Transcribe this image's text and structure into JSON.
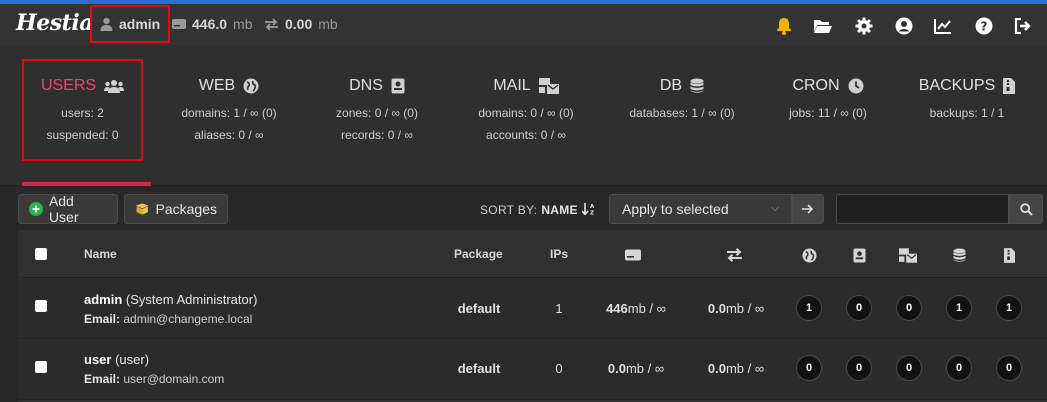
{
  "colors": {
    "accent": "#d0264f",
    "highlight": "#e10b16",
    "bell": "#f0b400",
    "addGreen": "#2fb34b"
  },
  "topbar": {
    "logo": "Hestia",
    "user": "admin",
    "disk_value": "446.0",
    "disk_unit": "mb",
    "bandwidth_value": "0.00",
    "bandwidth_unit": "mb",
    "icons": [
      "bell-icon",
      "folder-open-icon",
      "gear-icon",
      "user-circle-icon",
      "chart-line-icon",
      "question-icon",
      "logout-icon"
    ]
  },
  "stats": [
    {
      "title": "USERS",
      "icon": "users-icon",
      "lines": [
        "users: 2",
        "suspended: 0"
      ]
    },
    {
      "title": "WEB",
      "icon": "globe-icon",
      "lines": [
        "domains: 1 / ∞ (0)",
        "aliases: 0 / ∞"
      ]
    },
    {
      "title": "DNS",
      "icon": "dns-book-icon",
      "lines": [
        "zones: 0 / ∞ (0)",
        "records: 0 / ∞"
      ]
    },
    {
      "title": "MAIL",
      "icon": "mail-bulk-icon",
      "lines": [
        "domains: 0 / ∞ (0)",
        "accounts: 0 / ∞"
      ]
    },
    {
      "title": "DB",
      "icon": "database-icon",
      "lines": [
        "databases: 1 / ∞ (0)"
      ]
    },
    {
      "title": "CRON",
      "icon": "clock-icon",
      "lines": [
        "jobs: 11 / ∞ (0)"
      ]
    },
    {
      "title": "BACKUPS",
      "icon": "file-archive-icon",
      "lines": [
        "backups: 1 / 1"
      ]
    }
  ],
  "toolbar": {
    "add_user": "Add User",
    "packages": "Packages",
    "sort_by_label": "SORT BY:",
    "sort_by_value": "NAME",
    "bulk_action": "Apply to selected",
    "search_placeholder": ""
  },
  "table": {
    "headers": {
      "name": "Name",
      "package": "Package",
      "ips": "IPs"
    },
    "header_icons": [
      "disk-icon",
      "bandwidth-arrows-icon",
      "globe-icon",
      "dns-book-icon",
      "mail-bulk-icon",
      "database-icon",
      "file-archive-icon"
    ],
    "rows": [
      {
        "username": "admin",
        "fullname": "(System Administrator)",
        "email_label": "Email:",
        "email": "admin@changeme.local",
        "package": "default",
        "ips": "1",
        "disk_value": "446",
        "disk_unit": "mb / ∞",
        "bw_value": "0.0",
        "bw_unit": "mb / ∞",
        "counts": [
          "1",
          "0",
          "0",
          "1",
          "1"
        ]
      },
      {
        "username": "user",
        "fullname": "(user)",
        "email_label": "Email:",
        "email": "user@domain.com",
        "package": "default",
        "ips": "0",
        "disk_value": "0.0",
        "disk_unit": "mb / ∞",
        "bw_value": "0.0",
        "bw_unit": "mb / ∞",
        "counts": [
          "0",
          "0",
          "0",
          "0",
          "0"
        ]
      }
    ]
  }
}
